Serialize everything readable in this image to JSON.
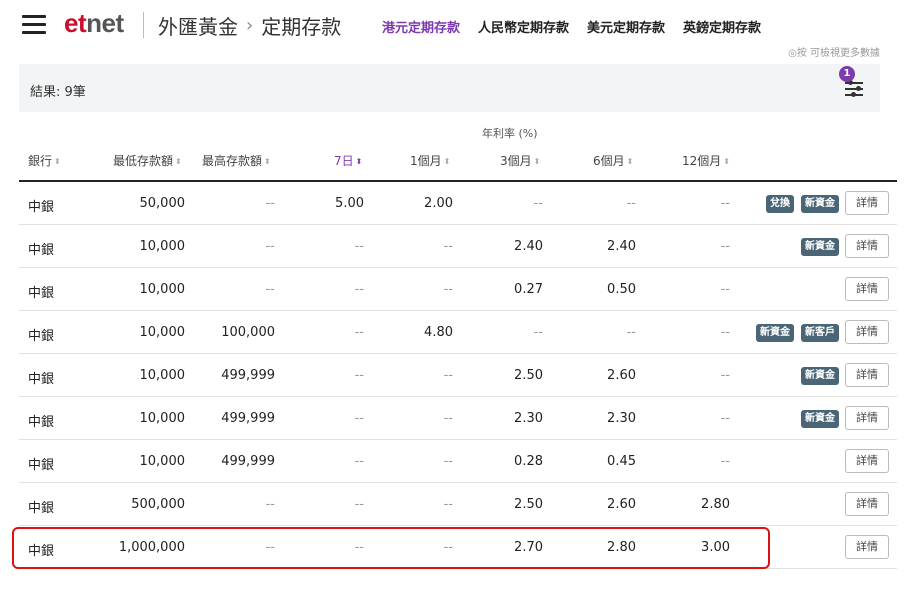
{
  "header": {
    "logo_et": "et",
    "logo_net": "net",
    "breadcrumb": [
      "外匯黃金",
      "定期存款"
    ],
    "breadcrumb_sep": "›",
    "tabs": [
      {
        "label": "港元定期存款",
        "active": true
      },
      {
        "label": "人民幣定期存款",
        "active": false
      },
      {
        "label": "美元定期存款",
        "active": false
      },
      {
        "label": "英鎊定期存款",
        "active": false
      }
    ],
    "hint": "◎按 可檢視更多數據"
  },
  "result": {
    "text": "結果: 9筆",
    "filter_count": "1"
  },
  "table": {
    "rate_group": "年利率 (%)",
    "columns": [
      "銀行",
      "最低存款額",
      "最高存款額",
      "7日",
      "1個月",
      "3個月",
      "6個月",
      "12個月"
    ],
    "sorted_column": "7日",
    "detail_label": "詳情",
    "rows": [
      {
        "bank": "中銀",
        "min": "50,000",
        "max": "--",
        "d7": "5.00",
        "m1": "2.00",
        "m3": "--",
        "m6": "--",
        "m12": "--",
        "tags": [
          "兌換",
          "新資金"
        ]
      },
      {
        "bank": "中銀",
        "min": "10,000",
        "max": "--",
        "d7": "--",
        "m1": "--",
        "m3": "2.40",
        "m6": "2.40",
        "m12": "--",
        "tags": [
          "新資金"
        ]
      },
      {
        "bank": "中銀",
        "min": "10,000",
        "max": "--",
        "d7": "--",
        "m1": "--",
        "m3": "0.27",
        "m6": "0.50",
        "m12": "--",
        "tags": []
      },
      {
        "bank": "中銀",
        "min": "10,000",
        "max": "100,000",
        "d7": "--",
        "m1": "4.80",
        "m3": "--",
        "m6": "--",
        "m12": "--",
        "tags": [
          "新資金",
          "新客戶"
        ]
      },
      {
        "bank": "中銀",
        "min": "10,000",
        "max": "499,999",
        "d7": "--",
        "m1": "--",
        "m3": "2.50",
        "m6": "2.60",
        "m12": "--",
        "tags": [
          "新資金"
        ]
      },
      {
        "bank": "中銀",
        "min": "10,000",
        "max": "499,999",
        "d7": "--",
        "m1": "--",
        "m3": "2.30",
        "m6": "2.30",
        "m12": "--",
        "tags": [
          "新資金"
        ]
      },
      {
        "bank": "中銀",
        "min": "10,000",
        "max": "499,999",
        "d7": "--",
        "m1": "--",
        "m3": "0.28",
        "m6": "0.45",
        "m12": "--",
        "tags": []
      },
      {
        "bank": "中銀",
        "min": "500,000",
        "max": "--",
        "d7": "--",
        "m1": "--",
        "m3": "2.50",
        "m6": "2.60",
        "m12": "2.80",
        "tags": []
      },
      {
        "bank": "中銀",
        "min": "1,000,000",
        "max": "--",
        "d7": "--",
        "m1": "--",
        "m3": "2.70",
        "m6": "2.80",
        "m12": "3.00",
        "tags": []
      }
    ]
  },
  "colors": {
    "accent": "#7c3aad",
    "brand": "#c8102e",
    "tag_bg": "#4a6576",
    "highlight": "#dd1111"
  }
}
